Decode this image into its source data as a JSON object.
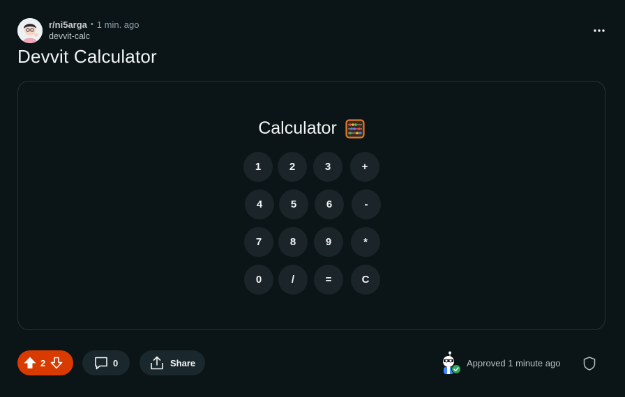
{
  "post": {
    "subreddit": "r/ni5arga",
    "separator": "•",
    "time": "1 min. ago",
    "app": "devvit-calc",
    "title": "Devvit Calculator"
  },
  "app_card": {
    "title": "Calculator",
    "icon": "abacus-icon",
    "keys": [
      [
        "1",
        "2",
        "3",
        "+"
      ],
      [
        "4",
        "5",
        "6",
        "-"
      ],
      [
        "7",
        "8",
        "9",
        "*"
      ],
      [
        "0",
        "/",
        "=",
        "C"
      ]
    ]
  },
  "actions": {
    "vote_count": "2",
    "comment_count": "0",
    "share_label": "Share",
    "approved_text": "Approved 1 minute ago"
  },
  "colors": {
    "background": "#0b1416",
    "upvoted": "#d93a00",
    "button_bg": "#1a282d",
    "key_bg": "#1b2529"
  }
}
